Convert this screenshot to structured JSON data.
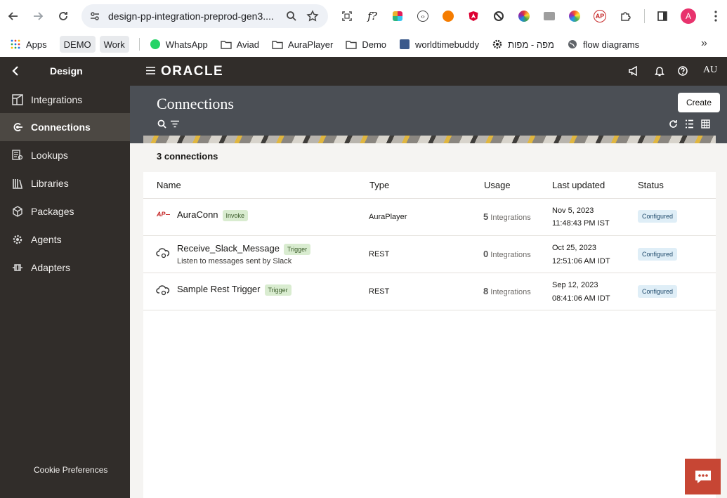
{
  "browser": {
    "url": "design-pp-integration-preprod-gen3....",
    "avatar_letter": "A",
    "extensions": [
      "screenshot-icon",
      "font-icon",
      "slack-icon",
      "code-icon",
      "orange-ext-icon",
      "angular-icon",
      "block-icon",
      "color-wheel-icon",
      "folder-ext-icon",
      "palette-icon",
      "auraplayer-icon",
      "puzzle-icon"
    ]
  },
  "bookmarks": [
    {
      "label": "Apps",
      "icon": "apps-grid-icon",
      "type": "plain"
    },
    {
      "label": "DEMO",
      "icon": "",
      "type": "chip"
    },
    {
      "label": "Work",
      "icon": "",
      "type": "chip"
    },
    {
      "label": "WhatsApp",
      "icon": "whatsapp-icon",
      "type": "plain"
    },
    {
      "label": "Aviad",
      "icon": "folder-icon",
      "type": "plain"
    },
    {
      "label": "AuraPlayer",
      "icon": "folder-icon",
      "type": "plain"
    },
    {
      "label": "Demo",
      "icon": "folder-icon",
      "type": "plain"
    },
    {
      "label": "worldtimebuddy",
      "icon": "wtb-icon",
      "type": "plain"
    },
    {
      "label": "מפה - מפות",
      "icon": "gear-icon",
      "type": "plain"
    },
    {
      "label": "flow diagrams",
      "icon": "globe-icon",
      "type": "plain"
    }
  ],
  "header": {
    "section": "Design",
    "logo": "ORACLE",
    "user": "AU"
  },
  "sidebar": {
    "items": [
      {
        "label": "Integrations",
        "icon": "integrations-icon"
      },
      {
        "label": "Connections",
        "icon": "connections-icon"
      },
      {
        "label": "Lookups",
        "icon": "lookups-icon"
      },
      {
        "label": "Libraries",
        "icon": "libraries-icon"
      },
      {
        "label": "Packages",
        "icon": "packages-icon"
      },
      {
        "label": "Agents",
        "icon": "agents-icon"
      },
      {
        "label": "Adapters",
        "icon": "adapters-icon"
      }
    ],
    "active": "Connections",
    "cookie": "Cookie Preferences"
  },
  "page": {
    "title": "Connections",
    "create_label": "Create",
    "count_text": "3 connections"
  },
  "table": {
    "headers": {
      "name": "Name",
      "type": "Type",
      "usage": "Usage",
      "updated": "Last updated",
      "status": "Status"
    },
    "rows": [
      {
        "name": "AuraConn",
        "badge": "Invoke",
        "description": "",
        "type": "AuraPlayer",
        "usage_count": "5",
        "usage_label": "Integrations",
        "date": "Nov 5, 2023",
        "time": "11:48:43 PM IST",
        "status": "Configured",
        "icon": "auraplayer-icon"
      },
      {
        "name": "Receive_Slack_Message",
        "badge": "Trigger",
        "description": "Listen to messages sent by Slack",
        "type": "REST",
        "usage_count": "0",
        "usage_label": "Integrations",
        "date": "Oct 25, 2023",
        "time": "12:51:06 AM IDT",
        "status": "Configured",
        "icon": "rest-cloud-icon"
      },
      {
        "name": "Sample Rest Trigger",
        "badge": "Trigger",
        "description": "",
        "type": "REST",
        "usage_count": "8",
        "usage_label": "Integrations",
        "date": "Sep 12, 2023",
        "time": "08:41:06 AM IDT",
        "status": "Configured",
        "icon": "rest-cloud-icon"
      }
    ]
  },
  "colors": {
    "header_bg": "#312d2a",
    "banner_bg": "#4b4f55",
    "chat_button": "#c74634",
    "status_chip_bg": "#dfeef7"
  }
}
